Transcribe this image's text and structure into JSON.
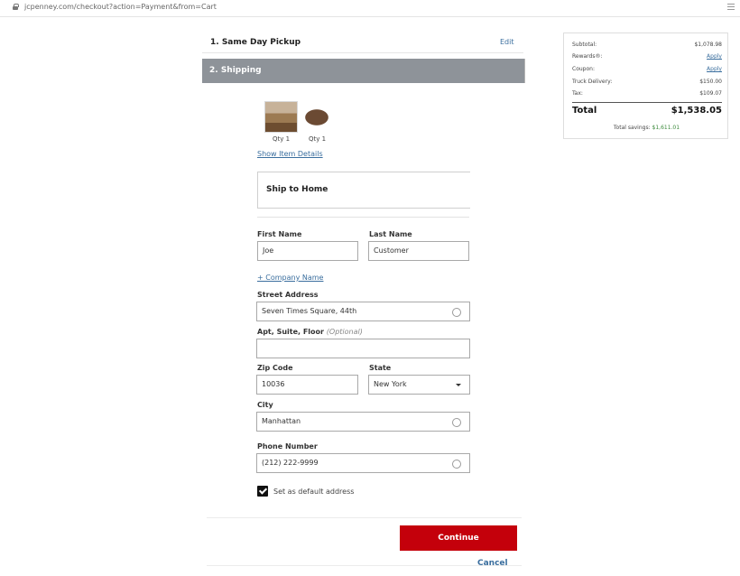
{
  "browser": {
    "url": "jcpenney.com/checkout?action=Payment&from=Cart"
  },
  "steps": {
    "step1": {
      "title": "1. Same Day Pickup",
      "edit": "Edit"
    },
    "step2": {
      "title": "2. Shipping"
    }
  },
  "items": [
    {
      "qty": "Qty 1"
    },
    {
      "qty": "Qty 1"
    }
  ],
  "show_details": "Show Item Details",
  "ship_option": "Ship to Home",
  "form": {
    "first_name": {
      "label": "First Name",
      "value": "Joe"
    },
    "last_name": {
      "label": "Last Name",
      "value": "Customer"
    },
    "company_link": "+ Company Name",
    "street": {
      "label": "Street Address",
      "value": "Seven Times Square, 44th"
    },
    "apt": {
      "label": "Apt, Suite, Floor",
      "optional": "(Optional)",
      "value": ""
    },
    "zip": {
      "label": "Zip Code",
      "value": "10036"
    },
    "state": {
      "label": "State",
      "value": "New York"
    },
    "city": {
      "label": "City",
      "value": "Manhattan"
    },
    "phone": {
      "label": "Phone Number",
      "value": "(212) 222-9999"
    },
    "default_address": {
      "label": "Set as default address",
      "checked": true
    }
  },
  "buttons": {
    "continue": "Continue",
    "cancel": "Cancel"
  },
  "summary": {
    "subtotal": {
      "label": "Subtotal:",
      "value": "$1,078.98"
    },
    "rewards": {
      "label": "Rewards®:",
      "value": "Apply"
    },
    "coupon": {
      "label": "Coupon:",
      "value": "Apply"
    },
    "truck": {
      "label": "Truck Delivery:",
      "value": "$150.00"
    },
    "tax": {
      "label": "Tax:",
      "value": "$109.07"
    },
    "total": {
      "label": "Total",
      "value": "$1,538.05"
    },
    "savings": {
      "label": "Total savings:",
      "value": "$1,611.01"
    }
  },
  "colors": {
    "accent": "#c4000b",
    "link": "#3a6e9e",
    "step_header": "#8e9399"
  }
}
